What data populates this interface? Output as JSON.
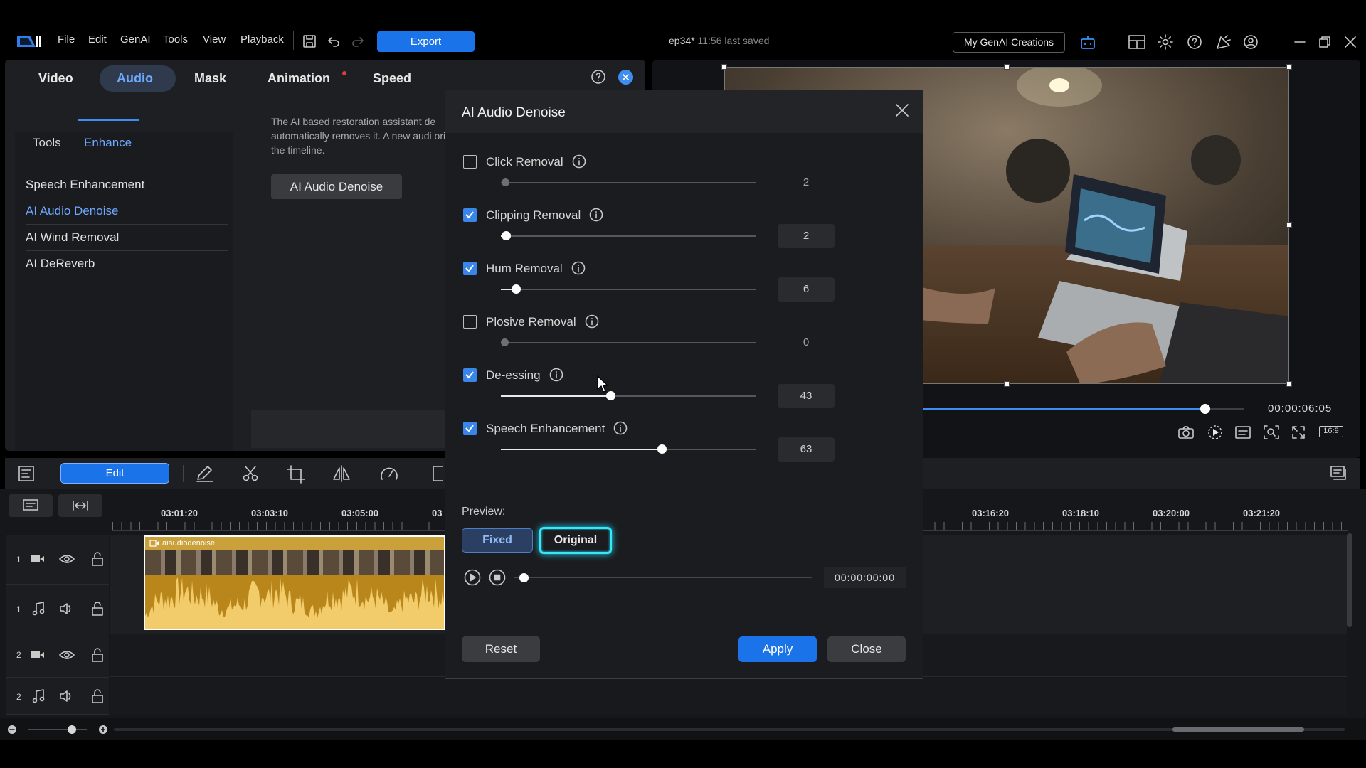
{
  "menu": {
    "file": "File",
    "edit": "Edit",
    "genai": "GenAI",
    "tools": "Tools",
    "view": "View",
    "playback": "Playback",
    "export": "Export"
  },
  "doc": {
    "title": "ep34*",
    "saved": "11:56 last saved"
  },
  "header": {
    "genai_creations": "My GenAI Creations"
  },
  "tabs": {
    "video": "Video",
    "audio": "Audio",
    "mask": "Mask",
    "animation": "Animation",
    "speed": "Speed"
  },
  "subtabs": {
    "tools": "Tools",
    "enhance": "Enhance"
  },
  "side_items": [
    "Speech Enhancement",
    "AI Audio Denoise",
    "AI Wind Removal",
    "AI DeReverb"
  ],
  "description": "The AI based restoration assistant de automatically removes it. A new audi original on the timeline.",
  "panel_button": "AI Audio Denoise",
  "player": {
    "time": "00:00:06:05",
    "progress": 0.88,
    "aspect": "16:9"
  },
  "toolbar": {
    "edit": "Edit"
  },
  "timeline": {
    "ruler_left": [
      "03:01:20",
      "03:03:10",
      "03:05:00",
      "03"
    ],
    "ruler_right": [
      "03:16:20",
      "03:18:10",
      "03:20:00",
      "03:21:20"
    ],
    "clip_name": "aiaudiodenoise",
    "tracks": [
      "1",
      "1",
      "2",
      "2"
    ]
  },
  "dialog": {
    "title": "AI Audio Denoise",
    "options": [
      {
        "label": "Click Removal",
        "checked": false,
        "value": "2",
        "fraction": 0.02
      },
      {
        "label": "Clipping Removal",
        "checked": true,
        "value": "2",
        "fraction": 0.02
      },
      {
        "label": "Hum Removal",
        "checked": true,
        "value": "6",
        "fraction": 0.06
      },
      {
        "label": "Plosive Removal",
        "checked": false,
        "value": "0",
        "fraction": 0.0
      },
      {
        "label": "De-essing",
        "checked": true,
        "value": "43",
        "fraction": 0.43
      },
      {
        "label": "Speech Enhancement",
        "checked": true,
        "value": "63",
        "fraction": 0.63
      }
    ],
    "preview_label": "Preview:",
    "fixed": "Fixed",
    "original": "Original",
    "time": "00:00:00:00",
    "reset": "Reset",
    "apply": "Apply",
    "close": "Close"
  },
  "colors": {
    "accent": "#1a73e8",
    "clip": "#c8961e",
    "glow": "#39e6f2"
  }
}
